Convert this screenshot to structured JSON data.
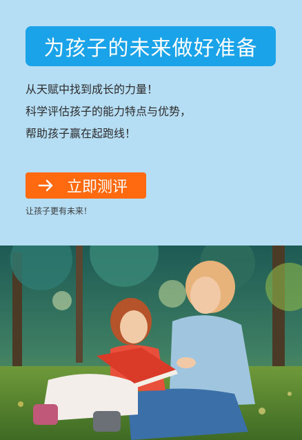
{
  "headline": "为孩子的未来做好准备",
  "intro_lines": [
    "从天赋中找到成长的力量！",
    "科学评估孩子的能力特点与优势，",
    "帮助孩子赢在起跑线！"
  ],
  "cta": {
    "label": "立即测评",
    "icon": "arrow-right-icon",
    "subtext": "让孩子更有未来！"
  },
  "colors": {
    "background": "#b5ddf3",
    "headline_banner": "#1aa3e8",
    "cta_button": "#ff6a10"
  },
  "photo": {
    "subject": "mother-and-daughter-reading-on-grass"
  }
}
